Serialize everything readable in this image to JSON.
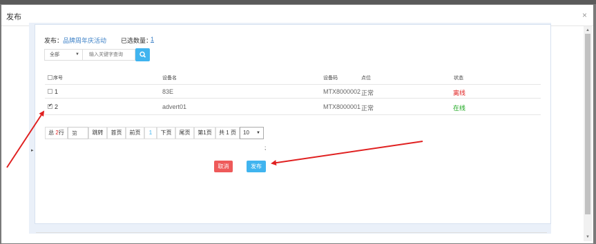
{
  "modal": {
    "title": "发布",
    "close": "×"
  },
  "publish": {
    "label": "发布：",
    "activity": "品牌周年庆活动",
    "selected_label": "已选数量：",
    "selected_count": "1"
  },
  "filter": {
    "dropdown_value": "全部",
    "search_placeholder": "输入关键字查询"
  },
  "table": {
    "headers": {
      "index": "序号",
      "name": "设备名",
      "code": "设备码",
      "point": "点位",
      "status": "状态"
    },
    "rows": [
      {
        "index": "1",
        "name": "83E",
        "code": "MTX8000002",
        "point": "正常",
        "status": "离线",
        "checked": false
      },
      {
        "index": "2",
        "name": "advert01",
        "code": "MTX8000001",
        "point": "正常",
        "status": "在线",
        "checked": true
      }
    ]
  },
  "pagination": {
    "total_prefix": "总",
    "total_count": "2",
    "total_suffix": "行",
    "page_input_placeholder": "第",
    "jump": "跳转",
    "first": "首页",
    "prev": "前页",
    "current": "1",
    "next": "下页",
    "last": "尾页",
    "page_n": "第1页",
    "total_pages": "共 1 页",
    "page_size": "10"
  },
  "separator": ";",
  "buttons": {
    "cancel": "取消",
    "publish": "发布"
  },
  "colors": {
    "primary": "#40b4ef",
    "danger": "#ee5a5a",
    "offline": "#e02020",
    "online": "#17a51a",
    "annotation": "#e02020"
  }
}
